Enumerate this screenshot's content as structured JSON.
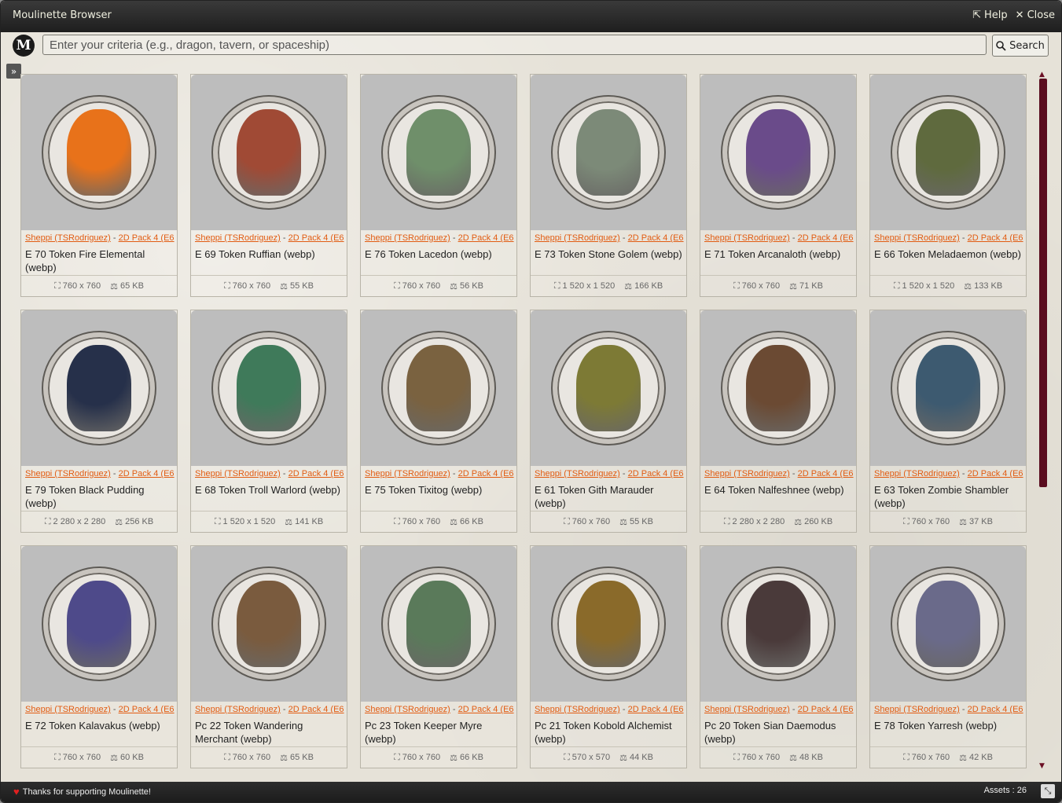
{
  "window": {
    "title": "Moulinette Browser",
    "help_label": "Help",
    "close_label": "Close"
  },
  "search": {
    "placeholder": "Enter your criteria (e.g., dragon, tavern, or spaceship)",
    "button_label": "Search",
    "logo_letter": "M"
  },
  "toggle": "»",
  "cards": [
    {
      "author": "Sheppi (TSRodriguez)",
      "pack": "2D Pack 4 (E6",
      "name": "E 70 Token Fire Elemental (webp)",
      "dims": "760 x 760",
      "size": "65 KB",
      "color": "#e8721a"
    },
    {
      "author": "Sheppi (TSRodriguez)",
      "pack": "2D Pack 4 (E6",
      "name": "E 69 Token Ruffian (webp)",
      "dims": "760 x 760",
      "size": "55 KB",
      "color": "#a04a35"
    },
    {
      "author": "Sheppi (TSRodriguez)",
      "pack": "2D Pack 4 (E6",
      "name": "E 76 Token Lacedon (webp)",
      "dims": "760 x 760",
      "size": "56 KB",
      "color": "#6f8f6a"
    },
    {
      "author": "Sheppi (TSRodriguez)",
      "pack": "2D Pack 4 (E6",
      "name": "E 73 Token Stone Golem (webp)",
      "dims": "1 520 x 1 520",
      "size": "166 KB",
      "color": "#7c8a78"
    },
    {
      "author": "Sheppi (TSRodriguez)",
      "pack": "2D Pack 4 (E6",
      "name": "E 71 Token Arcanaloth (webp)",
      "dims": "760 x 760",
      "size": "71 KB",
      "color": "#6a4b8a"
    },
    {
      "author": "Sheppi (TSRodriguez)",
      "pack": "2D Pack 4 (E6",
      "name": "E 66 Token Meladaemon (webp)",
      "dims": "1 520 x 1 520",
      "size": "133 KB",
      "color": "#5f6a3e"
    },
    {
      "author": "Sheppi (TSRodriguez)",
      "pack": "2D Pack 4 (E6",
      "name": "E 79 Token Black Pudding (webp)",
      "dims": "2 280 x 2 280",
      "size": "256 KB",
      "color": "#26304a"
    },
    {
      "author": "Sheppi (TSRodriguez)",
      "pack": "2D Pack 4 (E6",
      "name": "E 68 Token Troll Warlord (webp)",
      "dims": "1 520 x 1 520",
      "size": "141 KB",
      "color": "#3f7a5a"
    },
    {
      "author": "Sheppi (TSRodriguez)",
      "pack": "2D Pack 4 (E6",
      "name": "E 75 Token Tixitog (webp)",
      "dims": "760 x 760",
      "size": "66 KB",
      "color": "#7a6240"
    },
    {
      "author": "Sheppi (TSRodriguez)",
      "pack": "2D Pack 4 (E6",
      "name": "E 61 Token Gith Marauder (webp)",
      "dims": "760 x 760",
      "size": "55 KB",
      "color": "#7d7a35"
    },
    {
      "author": "Sheppi (TSRodriguez)",
      "pack": "2D Pack 4 (E6",
      "name": "E 64 Token Nalfeshnee (webp)",
      "dims": "2 280 x 2 280",
      "size": "260 KB",
      "color": "#6b4a33"
    },
    {
      "author": "Sheppi (TSRodriguez)",
      "pack": "2D Pack 4 (E6",
      "name": "E 63 Token Zombie Shambler (webp)",
      "dims": "760 x 760",
      "size": "37 KB",
      "color": "#3d5a70"
    },
    {
      "author": "Sheppi (TSRodriguez)",
      "pack": "2D Pack 4 (E6",
      "name": "E 72 Token Kalavakus (webp)",
      "dims": "760 x 760",
      "size": "60 KB",
      "color": "#4e4a8a"
    },
    {
      "author": "Sheppi (TSRodriguez)",
      "pack": "2D Pack 4 (E6",
      "name": "Pc 22 Token Wandering Merchant (webp)",
      "dims": "760 x 760",
      "size": "65 KB",
      "color": "#7a5b3e"
    },
    {
      "author": "Sheppi (TSRodriguez)",
      "pack": "2D Pack 4 (E6",
      "name": "Pc 23 Token Keeper Myre (webp)",
      "dims": "760 x 760",
      "size": "66 KB",
      "color": "#5a7a5a"
    },
    {
      "author": "Sheppi (TSRodriguez)",
      "pack": "2D Pack 4 (E6",
      "name": "Pc 21 Token Kobold Alchemist (webp)",
      "dims": "570 x 570",
      "size": "44 KB",
      "color": "#8a6a2a"
    },
    {
      "author": "Sheppi (TSRodriguez)",
      "pack": "2D Pack 4 (E6",
      "name": "Pc 20 Token Sian Daemodus (webp)",
      "dims": "760 x 760",
      "size": "48 KB",
      "color": "#4a3a3a"
    },
    {
      "author": "Sheppi (TSRodriguez)",
      "pack": "2D Pack 4 (E6",
      "name": "E 78 Token Yarresh (webp)",
      "dims": "760 x 760",
      "size": "42 KB",
      "color": "#6a6a8a"
    }
  ],
  "footer": {
    "thanks": "Thanks for supporting Moulinette!",
    "assets": "Assets : 26"
  },
  "colors": {
    "accent": "#e25c12",
    "scroll": "#5a0d1f"
  }
}
